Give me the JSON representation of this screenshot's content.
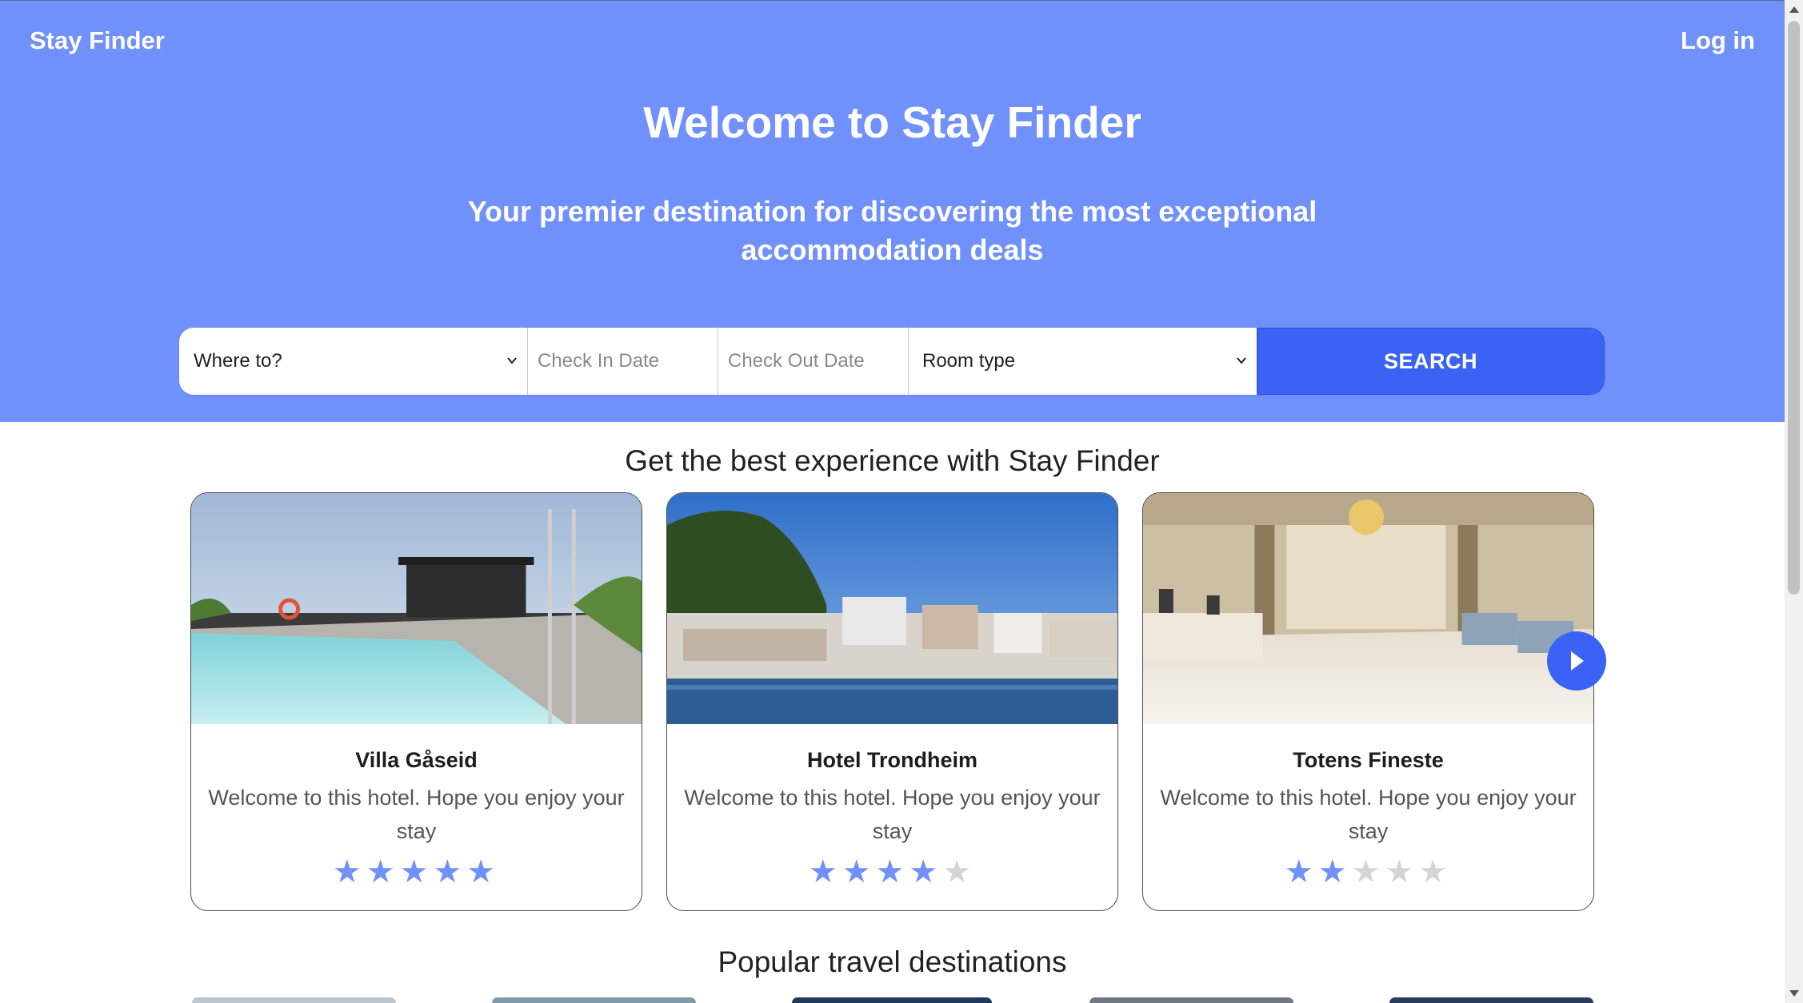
{
  "header": {
    "brand": "Stay Finder",
    "login": "Log in"
  },
  "hero": {
    "title": "Welcome to Stay Finder",
    "subtitle": "Your premier destination for discovering the most exceptional accommodation deals"
  },
  "search": {
    "destination": "Where to?",
    "check_in": "Check In Date",
    "check_out": "Check Out Date",
    "room_type": "Room type",
    "button": "SEARCH"
  },
  "featured": {
    "title": "Get the best experience with Stay Finder",
    "hotels": [
      {
        "name": "Villa Gåseid",
        "description": "Welcome to this hotel. Hope you enjoy your stay",
        "rating": 5,
        "max_rating": 5
      },
      {
        "name": "Hotel Trondheim",
        "description": "Welcome to this hotel. Hope you enjoy your stay",
        "rating": 4,
        "max_rating": 5
      },
      {
        "name": "Totens Fineste",
        "description": "Welcome to this hotel. Hope you enjoy your stay",
        "rating": 2,
        "max_rating": 5
      }
    ]
  },
  "destinations": {
    "title": "Popular travel destinations"
  },
  "colors": {
    "hero_bg": "#7090fc",
    "accent": "#3a63f5",
    "star_on": "#7090fc",
    "star_off": "#d5d5d5"
  },
  "icons": {
    "dropdown": "chevron-down-icon",
    "next": "play-arrow-icon",
    "star": "star-icon"
  }
}
